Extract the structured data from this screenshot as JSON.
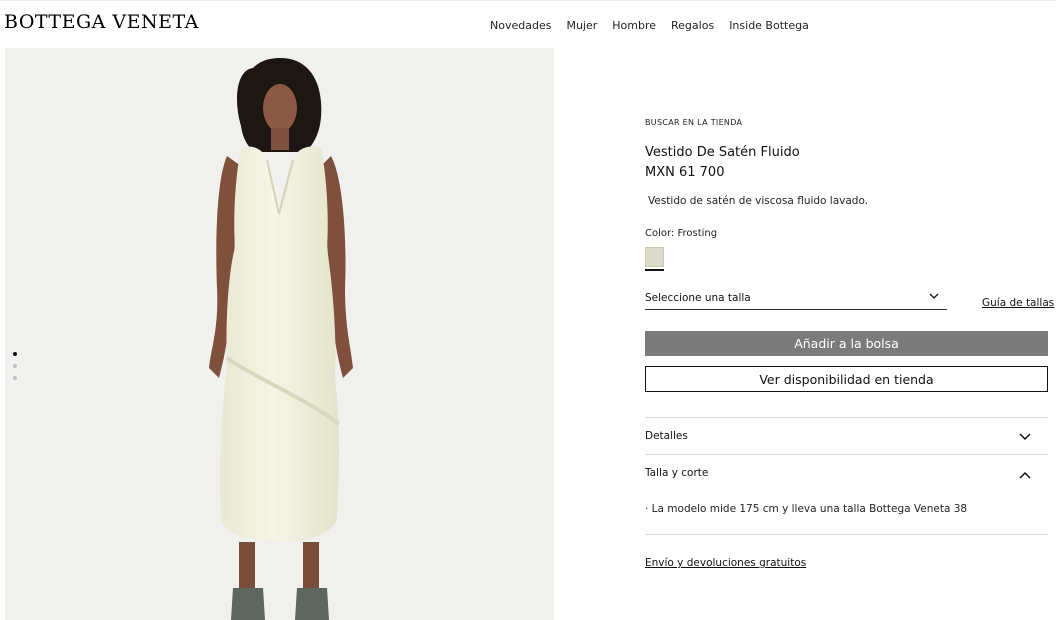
{
  "header": {
    "logo": "BOTTEGA VENETA",
    "nav": [
      "Novedades",
      "Mujer",
      "Hombre",
      "Regalos",
      "Inside Bottega"
    ]
  },
  "gallery": {
    "dots": 3,
    "active_dot": 0
  },
  "product": {
    "store_link": "BUSCAR EN LA TIENDA",
    "title": "Vestido De Satén Fluido",
    "price": "MXN 61 700",
    "description": "Vestido de satén de viscosa fluido lavado.",
    "color_label": "Color: Frosting",
    "swatch_color": "#dcdccd",
    "size_placeholder": "Seleccione una talla",
    "size_guide": "Guía de tallas",
    "add_to_bag": "Añadir a la bolsa",
    "store_availability": "Ver disponibilidad en tienda"
  },
  "accordion": {
    "details": {
      "title": "Detalles",
      "expanded": false
    },
    "fit": {
      "title": "Talla y corte",
      "expanded": true,
      "body": "· La modelo mide 175 cm y lleva una talla Bottega Veneta 38"
    }
  },
  "shipping_link": "Envío y devoluciones gratuitos",
  "colors": {
    "button_bg": "#7b7b7b",
    "image_bg": "#f0f0ef"
  }
}
